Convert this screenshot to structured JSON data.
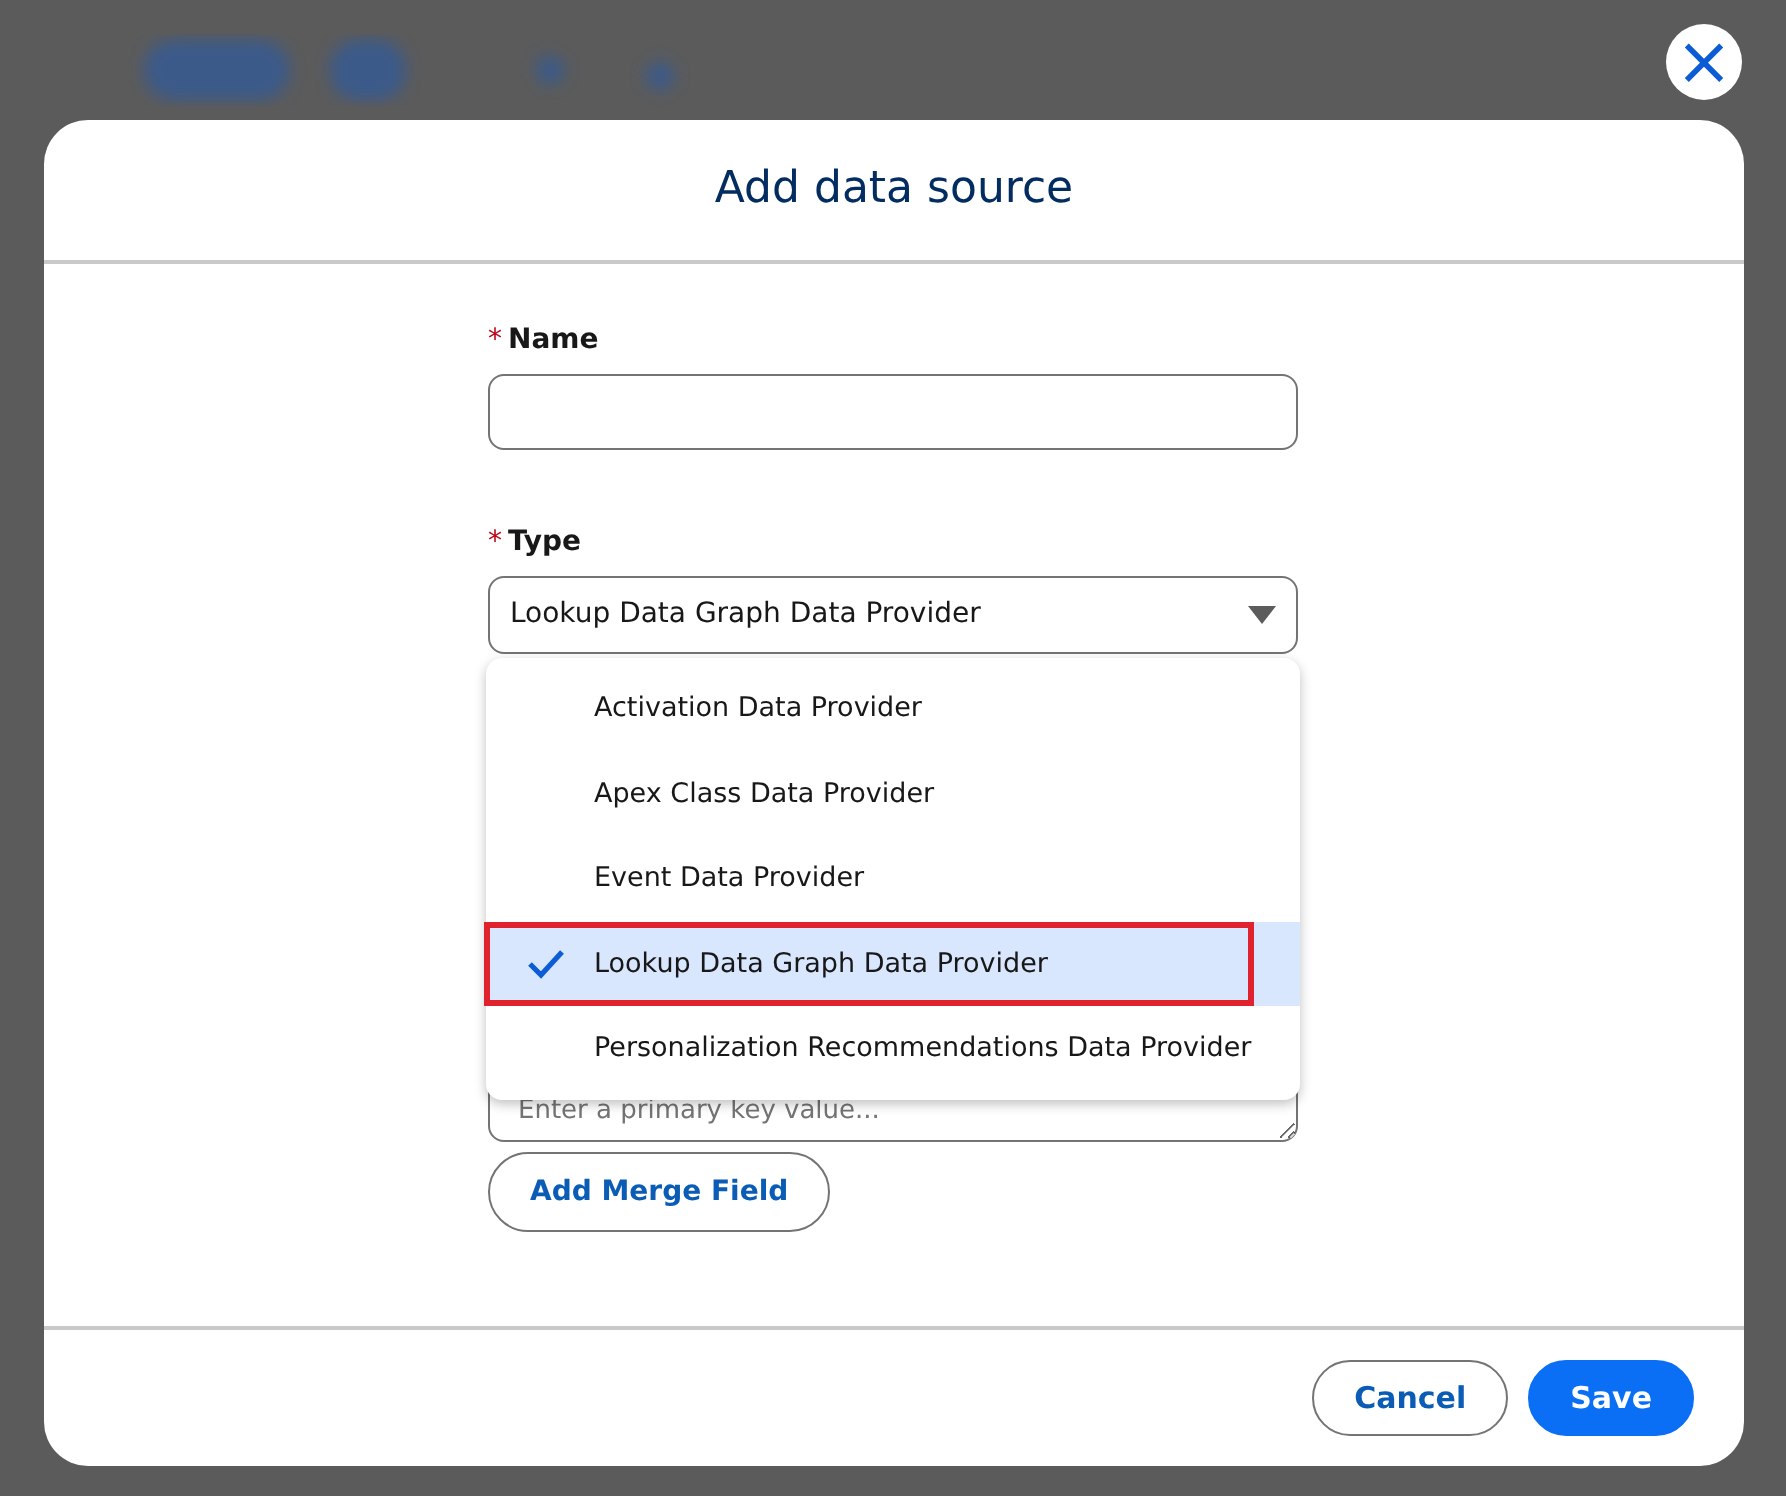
{
  "dialog": {
    "title": "Add data source",
    "close_icon": "×"
  },
  "fields": [
    {
      "kind": "input",
      "label": "Name",
      "required_mark": "*"
    },
    {
      "kind": "select",
      "label": "Type",
      "required_mark": "*",
      "value": "Lookup Data Graph Data Provider",
      "expanded": true,
      "options": [
        {
          "label": "Activation Data Provider",
          "selected": false,
          "highlighted": false
        },
        {
          "label": "Apex Class Data Provider",
          "selected": false,
          "highlighted": false
        },
        {
          "label": "Event Data Provider",
          "selected": false,
          "highlighted": false
        },
        {
          "label": "Lookup Data Graph Data Provider",
          "selected": true,
          "highlighted": true
        },
        {
          "label": "Personalization Recommendations Data Provider",
          "selected": false,
          "highlighted": false
        }
      ]
    },
    {
      "kind": "textarea",
      "placeholder": "Enter a primary key value..."
    }
  ],
  "merge_button": "Add Merge Field",
  "buttons": [
    {
      "label": "Cancel",
      "kind": "neutral"
    },
    {
      "label": "Save",
      "kind": "brand"
    }
  ]
}
